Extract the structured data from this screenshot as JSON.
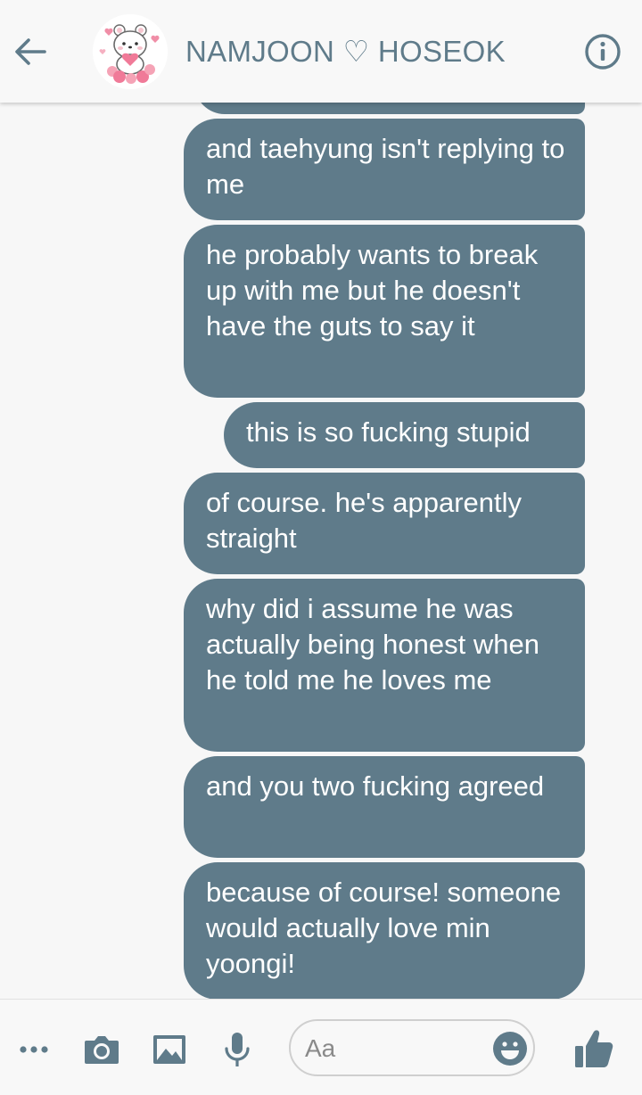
{
  "header": {
    "title": "NAMJOON ♡ HOSEOK",
    "back_icon": "arrow-left-icon",
    "info_icon": "info-circle-icon",
    "avatar": "bear-with-hearts-avatar"
  },
  "messages": [
    {
      "text": ""
    },
    {
      "text": "and taehyung isn't replying to me"
    },
    {
      "text": "he probably wants to break up with me but he doesn't have the guts to say it"
    },
    {
      "text": "this is so fucking stupid"
    },
    {
      "text": "of course. he's apparently straight"
    },
    {
      "text": "why did i assume he was actually being honest when he told me he loves me"
    },
    {
      "text": "and you two fucking agreed"
    },
    {
      "text": "because of course! someone would actually love min yoongi!"
    }
  ],
  "composer": {
    "more_icon": "more-dots-icon",
    "camera_icon": "camera-icon",
    "gallery_icon": "image-icon",
    "mic_icon": "microphone-icon",
    "placeholder": "Aa",
    "emoji_icon": "smiley-icon",
    "like_icon": "thumbs-up-icon"
  },
  "colors": {
    "accent": "#5f7b8a",
    "bubble_text": "#ffffff",
    "background": "#f7f7f7"
  }
}
